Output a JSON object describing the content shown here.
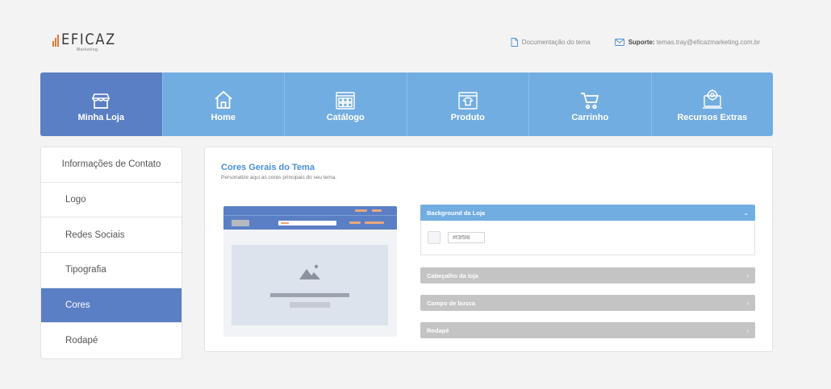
{
  "brand": {
    "name": "EFICAZ",
    "tagline": "Marketing",
    "bar_color": "#e07b39"
  },
  "top_links": {
    "docs": "Documentação do tema",
    "support_label": "Suporte:",
    "support_email": "temas.tray@eficazmarketing.com.br"
  },
  "nav": {
    "items": [
      {
        "label": "Minha Loja",
        "icon": "store-icon",
        "active": true
      },
      {
        "label": "Home",
        "icon": "home-icon"
      },
      {
        "label": "Catálogo",
        "icon": "catalog-icon"
      },
      {
        "label": "Produto",
        "icon": "product-icon"
      },
      {
        "label": "Carrinho",
        "icon": "cart-icon"
      },
      {
        "label": "Recursos Extras",
        "icon": "extras-icon"
      }
    ],
    "active_color": "#5b7fc4",
    "color": "#72ade1"
  },
  "sidebar": {
    "items": [
      {
        "label": "Informações de Contato"
      },
      {
        "label": "Logo"
      },
      {
        "label": "Redes Sociais"
      },
      {
        "label": "Tipografia"
      },
      {
        "label": "Cores",
        "active": true
      },
      {
        "label": "Rodapé"
      }
    ]
  },
  "main": {
    "title": "Cores Gerais do Tema",
    "subtitle": "Personalize aqui as cores principais do seu tema.",
    "sections": [
      {
        "label": "Background da Loja",
        "open": true,
        "color_value": "#f3f5f8",
        "chevron": "chevron-down-icon"
      },
      {
        "label": "Cabeçalho da loja",
        "open": false,
        "chevron": "chevron-right-icon"
      },
      {
        "label": "Campo de busca",
        "open": false,
        "chevron": "chevron-right-icon"
      },
      {
        "label": "Rodapé",
        "open": false,
        "chevron": "chevron-right-icon"
      }
    ],
    "chevron_down": "⌄",
    "chevron_right": "›"
  }
}
